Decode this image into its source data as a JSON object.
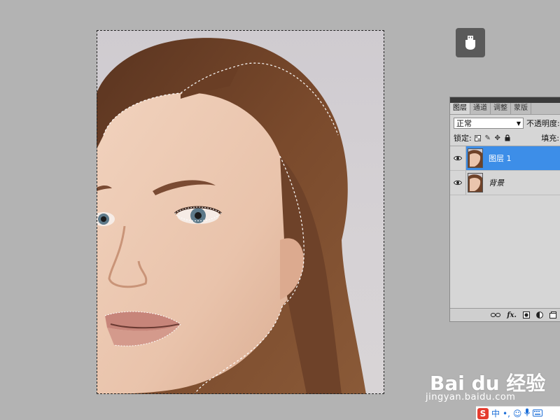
{
  "panel": {
    "tabs": [
      "图层",
      "通道",
      "调整",
      "蒙版"
    ],
    "blend_mode": "正常",
    "opacity_label": "不透明度:",
    "lock_label": "锁定:",
    "fill_label": "填充:",
    "layers": [
      {
        "name": "图层 1",
        "selected": true
      },
      {
        "name": "背景",
        "selected": false
      }
    ],
    "footer_icons": [
      "link-icon",
      "fx-icon",
      "mask-icon",
      "adjustment-icon",
      "new-layer-icon"
    ]
  },
  "watermark": {
    "main": "Bai du 经验",
    "sub": "jingyan.baidu.com"
  },
  "ime": {
    "logo": "S",
    "lang": "中",
    "icons": [
      "punctuation-icon",
      "emoji-icon",
      "mic-icon",
      "keyboard-icon"
    ]
  },
  "colors": {
    "selection": "#3d8ee8",
    "background": "#b3b3b3",
    "panel": "#d6d6d6"
  }
}
